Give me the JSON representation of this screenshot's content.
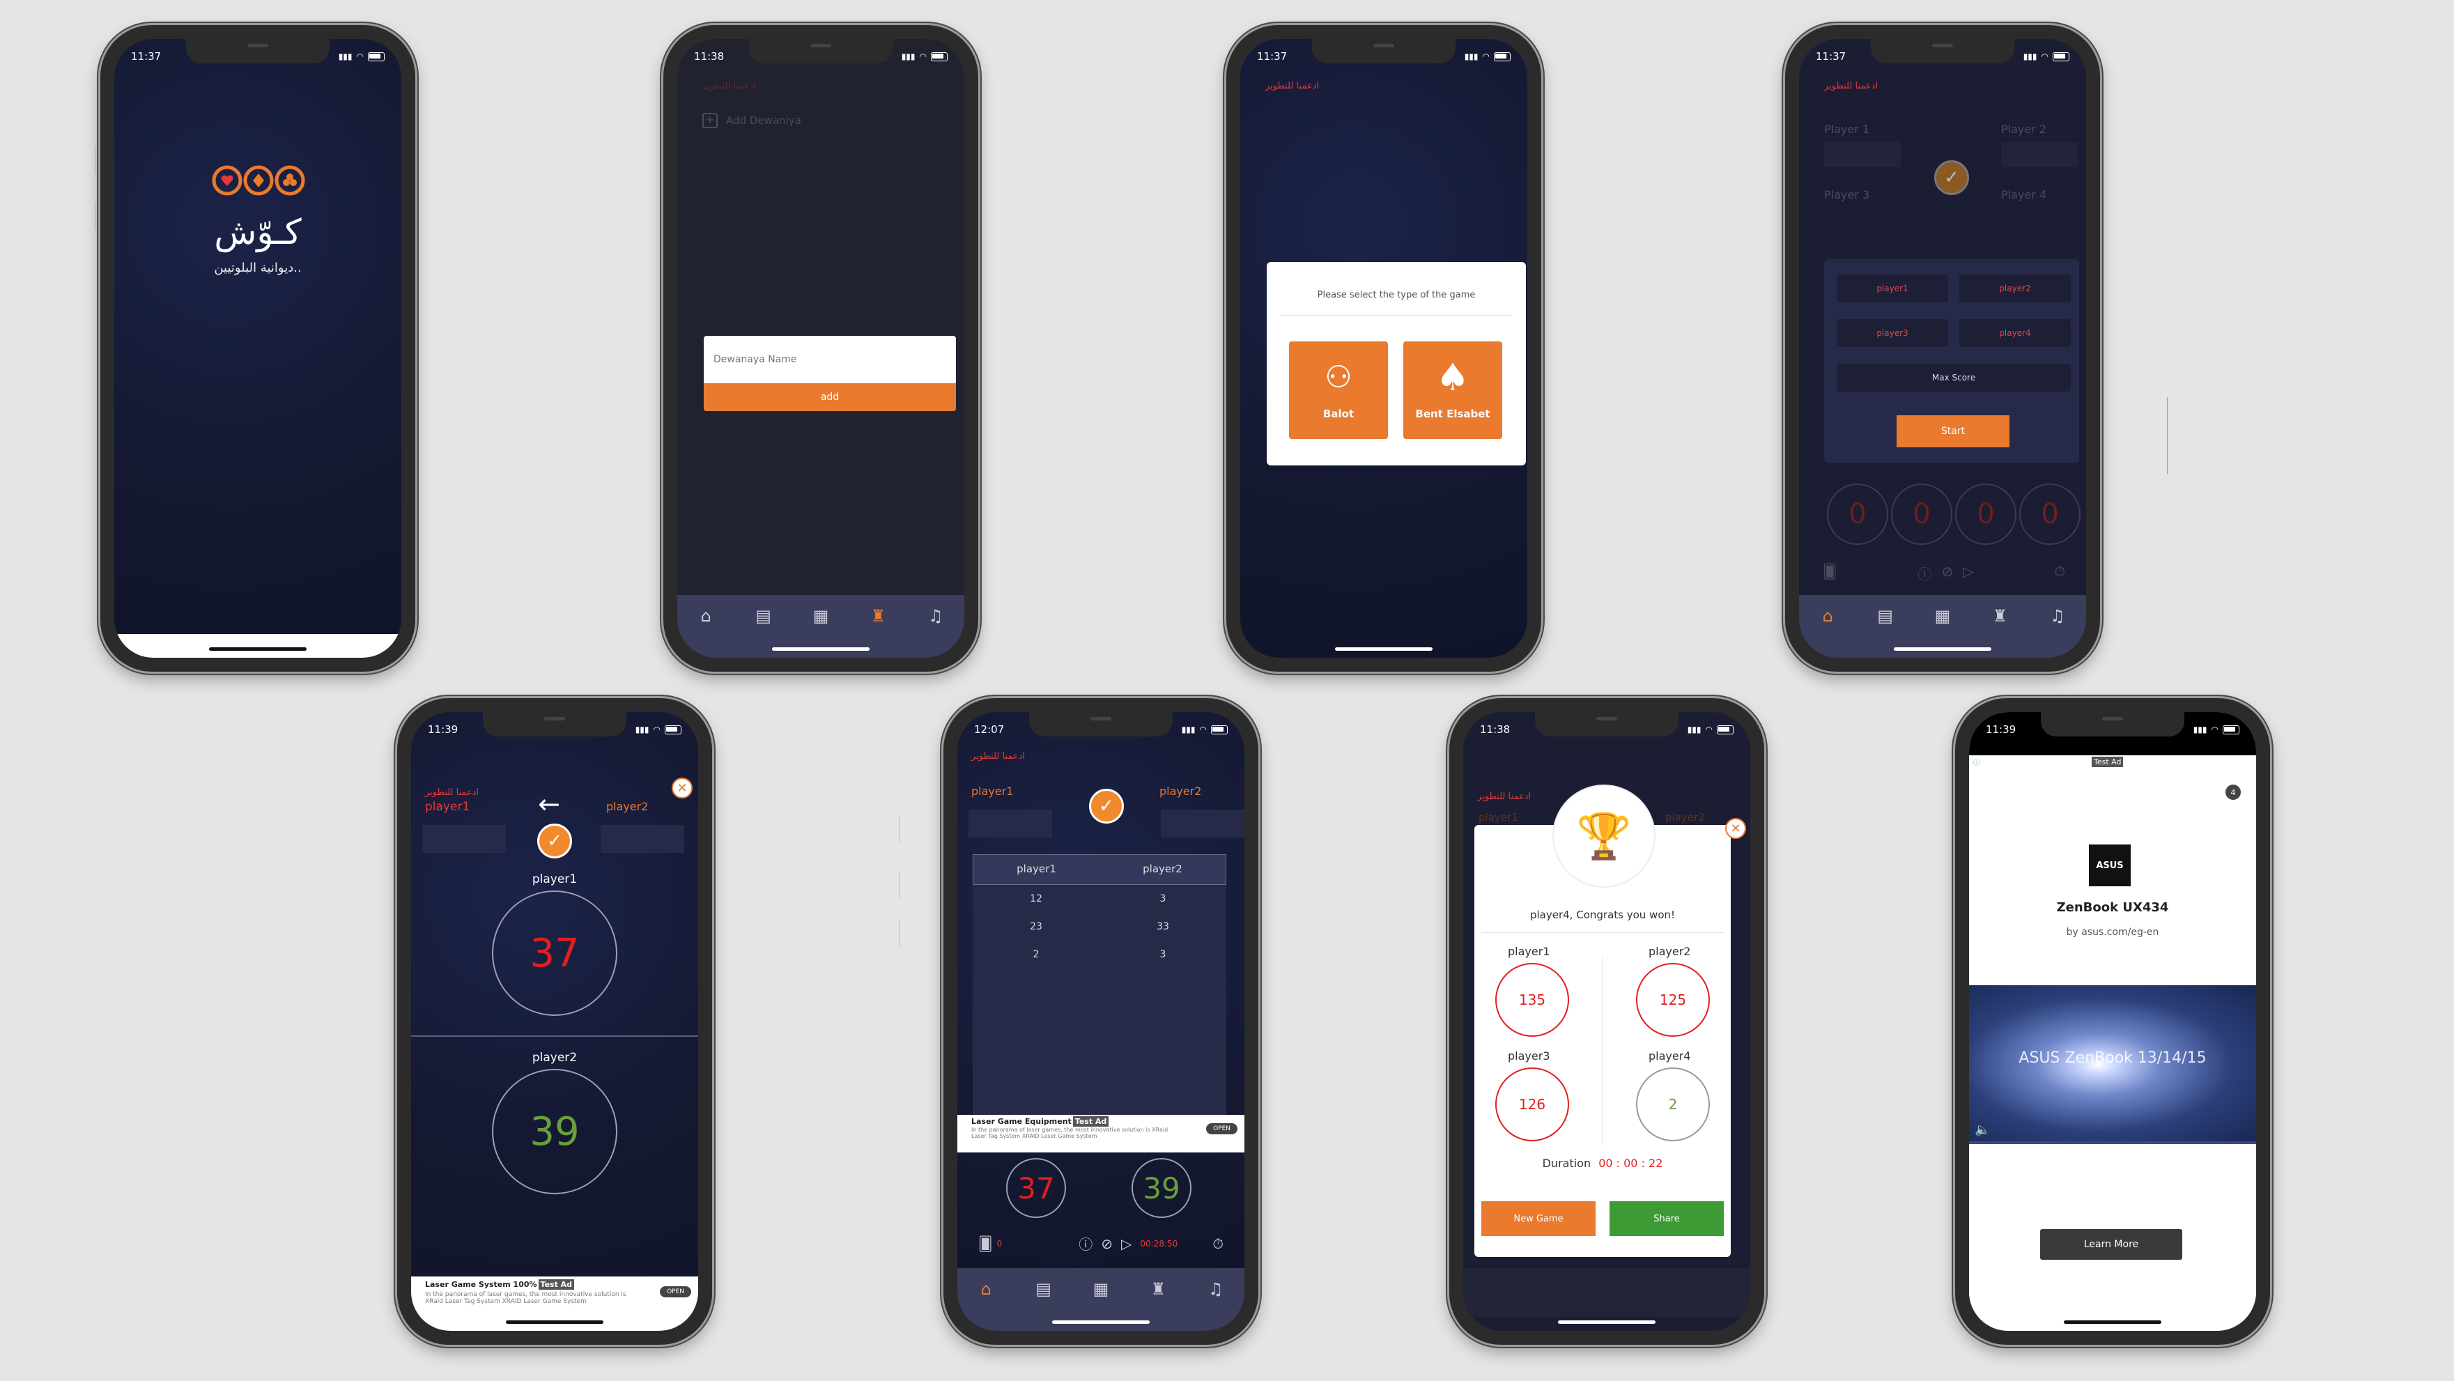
{
  "phones": {
    "p1": {
      "time": "11:37",
      "logo_text": "كـوّش",
      "tagline": "ديوانية البلوتيين.."
    },
    "p2": {
      "time": "11:38",
      "support_text": "ادعمنا للتطوير",
      "add_label": "Add Dewaniya",
      "name_placeholder": "Dewanaya Name",
      "add_button": "add"
    },
    "p3": {
      "time": "11:37",
      "support_text": "ادعمنا للتطوير",
      "prompt": "Please select the type of the game",
      "option1": "Balot",
      "option2": "Bent Elsabet"
    },
    "p4": {
      "time": "11:37",
      "support_text": "ادعمنا للتطوير",
      "slots": [
        "Player 1",
        "Player 2",
        "Player 3",
        "Player 4"
      ],
      "inputs": [
        "player1",
        "player2",
        "player3",
        "player4"
      ],
      "max_score": "Max Score",
      "start": "Start",
      "scores": [
        "0",
        "0",
        "0",
        "0"
      ]
    },
    "p5": {
      "time": "11:39",
      "support_text": "ادعمنا للتطوير",
      "team1": "player1",
      "team2": "player2",
      "score1": "37",
      "score2": "39",
      "ad_title": "Laser Game System 100%",
      "ad_badge": "Test Ad",
      "ad_body": "In the panorama of laser games, the most innovative solution is XRaid Laser Tag System XRAID Laser Game System",
      "ad_open": "OPEN"
    },
    "p6": {
      "time": "12:07",
      "support_text": "ادعمنا للتطوير",
      "team1": "player1",
      "team2": "player2",
      "table_head": [
        "player1",
        "player2"
      ],
      "rows": [
        [
          "12",
          "3"
        ],
        [
          "23",
          "33"
        ],
        [
          "2",
          "3"
        ]
      ],
      "ad_title": "Laser Game Equipment",
      "ad_badge": "Test Ad",
      "ad_body": "In the panorama of laser games, the most innovative solution is XRaid Laser Tag System XRAID Laser Game System",
      "ad_open": "OPEN",
      "score1": "37",
      "score2": "39",
      "small_score": "0",
      "timer": "00:28:50"
    },
    "p7": {
      "time": "11:38",
      "support_text": "ادعمنا للتطوير",
      "bg_p1": "player1",
      "bg_p2": "player2",
      "congrats": "player4, Congrats you won!",
      "players": [
        {
          "name": "player1",
          "score": "135"
        },
        {
          "name": "player2",
          "score": "125"
        },
        {
          "name": "player3",
          "score": "126"
        },
        {
          "name": "player4",
          "score": "2"
        }
      ],
      "duration_label": "Duration",
      "duration": "00 : 00 : 22",
      "new_game": "New Game",
      "share": "Share"
    },
    "p8": {
      "time": "11:39",
      "ad_badge": "Test Ad",
      "count": "4",
      "brand": "ASUS",
      "product": "ZenBook UX434",
      "by": "by asus.com/eg-en",
      "video_text": "ASUS ZenBook 13/14/15",
      "learn_more": "Learn More"
    }
  },
  "colors": {
    "accent": "#e97a2e",
    "score_red": "#e0201f",
    "score_green": "#6a9e3a",
    "share_green": "#3d9a35"
  }
}
